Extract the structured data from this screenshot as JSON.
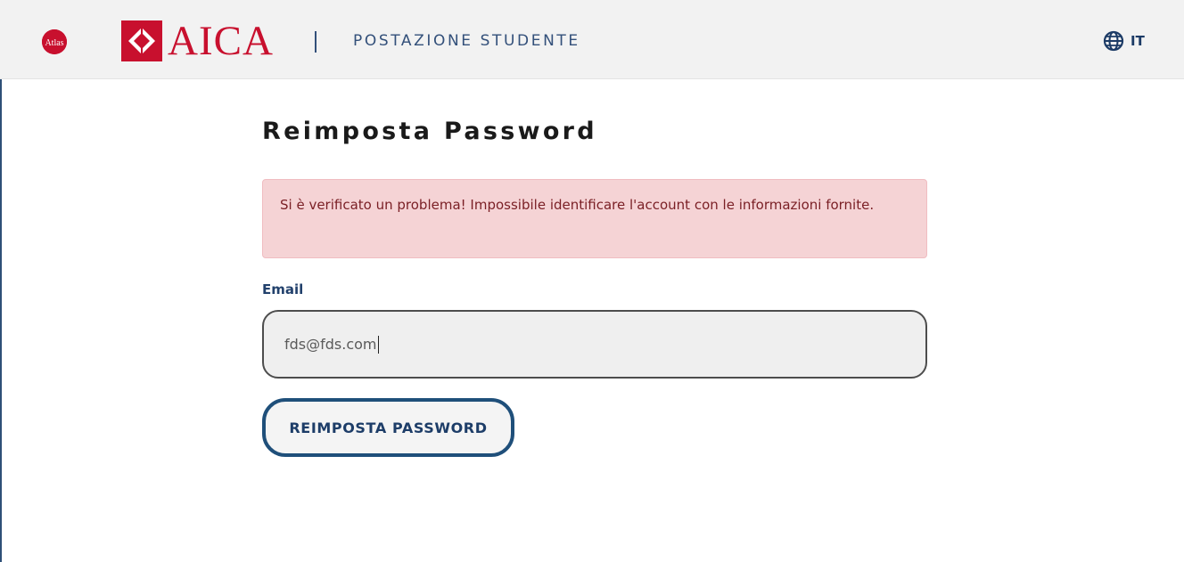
{
  "header": {
    "atlas_logo_text": "Atlas",
    "brand_name": "AICA",
    "title": "POSTAZIONE STUDENTE",
    "language": {
      "icon": "globe-icon",
      "code": "IT"
    }
  },
  "main": {
    "title": "Reimposta Password",
    "alert": {
      "message": "Si è verificato un problema! Impossibile identificare l'account con le informazioni fornite."
    },
    "email": {
      "label": "Email",
      "value": "fds@fds.com"
    },
    "submit_label": "REIMPOSTA PASSWORD"
  },
  "colors": {
    "brand_red": "#c8102e",
    "navy": "#1f4f7a",
    "alert_bg": "#f5d3d5",
    "alert_text": "#7a1f25"
  }
}
